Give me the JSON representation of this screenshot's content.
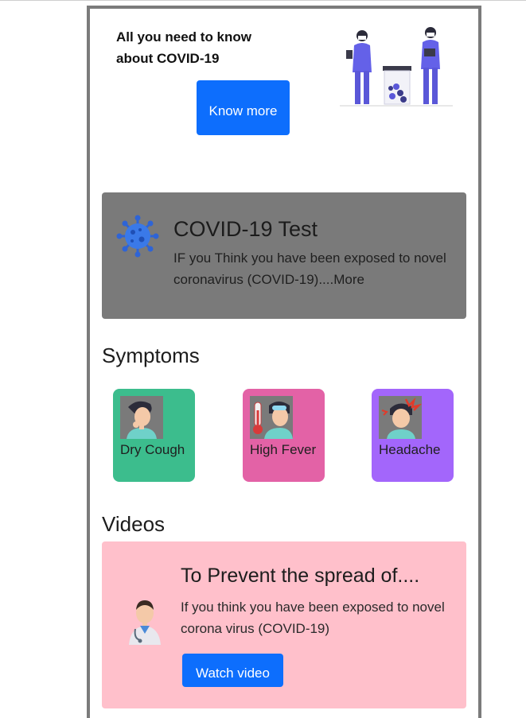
{
  "hero": {
    "title": "All you need to know about COVID-19",
    "button_label": "Know more",
    "illustration": "doctors-testing-illustration"
  },
  "test_card": {
    "icon": "virus-icon",
    "title": "COVID-19 Test",
    "text": "IF you Think you have been exposed to novel coronavirus (COVID-19)....More"
  },
  "symptoms": {
    "heading": "Symptoms",
    "items": [
      {
        "label": "Dry Cough",
        "icon": "dry-cough-icon",
        "color": "#3cbd8d"
      },
      {
        "label": "High Fever",
        "icon": "high-fever-icon",
        "color": "#e362a6"
      },
      {
        "label": "Headache",
        "icon": "headache-icon",
        "color": "#a366fb"
      }
    ]
  },
  "videos": {
    "heading": "Videos",
    "card": {
      "icon": "doctor-icon",
      "title": "To Prevent the spread of....",
      "text": "If you think you have been exposed to novel corona virus (COVID-19)",
      "button_label": "Watch video"
    }
  },
  "colors": {
    "primary": "#0d6efd",
    "test_card_bg": "#7a7a7a",
    "video_card_bg": "#ffc0cb"
  }
}
